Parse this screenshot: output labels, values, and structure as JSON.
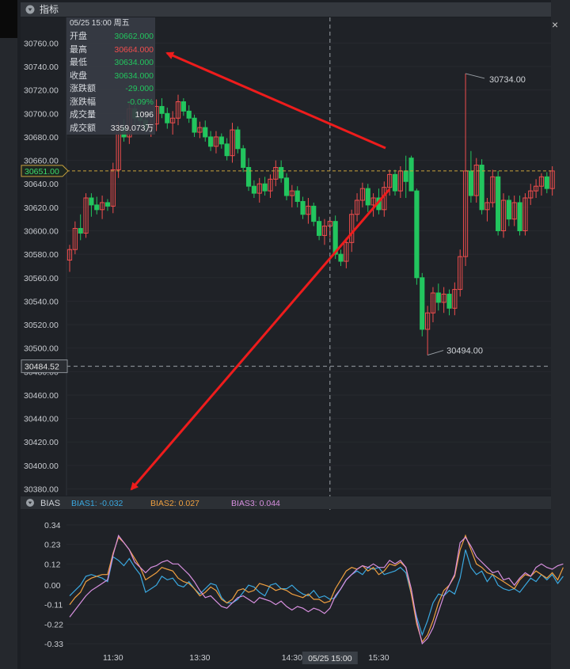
{
  "panel": {
    "title": "指标",
    "bias_title": "BIAS"
  },
  "crosshair": {
    "price_label": "30484.52",
    "time_label": "05/25 15:00",
    "ref_price_label": "30651.00"
  },
  "tooltip": {
    "header": "05/25 15:00 周五",
    "rows": [
      {
        "label": "开盘",
        "value": "30662.000",
        "tone": "dn"
      },
      {
        "label": "最高",
        "value": "30664.000",
        "tone": "up"
      },
      {
        "label": "最低",
        "value": "30634.000",
        "tone": "dn"
      },
      {
        "label": "收盘",
        "value": "30634.000",
        "tone": "dn"
      },
      {
        "label": "涨跌额",
        "value": "-29.000",
        "tone": "dn"
      },
      {
        "label": "涨跌幅",
        "value": "-0.09%",
        "tone": "dn"
      },
      {
        "label": "成交量",
        "value": "1096",
        "tone": "nt"
      },
      {
        "label": "成交额",
        "value": "3359.073万",
        "tone": "nt"
      }
    ]
  },
  "annotations": {
    "high": "30734.00",
    "low": "30494.00"
  },
  "bias_legend": [
    {
      "label": "BIAS1: -0.032",
      "color": "#3aa8e0"
    },
    {
      "label": "BIAS2: 0.027",
      "color": "#f0a040"
    },
    {
      "label": "BIAS3: 0.044",
      "color": "#d890e0"
    }
  ],
  "colors": {
    "up": "#ef4d4d",
    "down": "#22c55e",
    "arrow": "#ee1c1c"
  },
  "chart_data": [
    {
      "type": "candlestick",
      "y_ticks": [
        30380,
        30400,
        30420,
        30440,
        30460,
        30480,
        30500,
        30520,
        30540,
        30560,
        30580,
        30600,
        30620,
        30640,
        30660,
        30680,
        30700,
        30720,
        30740,
        30760
      ],
      "ylim": [
        30380,
        30765
      ],
      "ohlc": [
        [
          30575,
          30588,
          30565,
          30584
        ],
        [
          30584,
          30608,
          30580,
          30602
        ],
        [
          30602,
          30614,
          30592,
          30598
        ],
        [
          30598,
          30632,
          30594,
          30628
        ],
        [
          30628,
          30632,
          30612,
          30622
        ],
        [
          30622,
          30629,
          30614,
          30618
        ],
        [
          30618,
          30630,
          30610,
          30624
        ],
        [
          30624,
          30627,
          30617,
          30621
        ],
        [
          30621,
          30658,
          30615,
          30652
        ],
        [
          30652,
          30693,
          30645,
          30688
        ],
        [
          30688,
          30695,
          30676,
          30680
        ],
        [
          30680,
          30709,
          30674,
          30704
        ],
        [
          30704,
          30711,
          30690,
          30696
        ],
        [
          30696,
          30703,
          30687,
          30694
        ],
        [
          30694,
          30701,
          30684,
          30687
        ],
        [
          30687,
          30695,
          30680,
          30691
        ],
        [
          30691,
          30712,
          30685,
          30706
        ],
        [
          30706,
          30713,
          30696,
          30700
        ],
        [
          30700,
          30705,
          30687,
          30692
        ],
        [
          30692,
          30702,
          30682,
          30696
        ],
        [
          30696,
          30716,
          30690,
          30710
        ],
        [
          30710,
          30713,
          30698,
          30702
        ],
        [
          30702,
          30707,
          30692,
          30696
        ],
        [
          30696,
          30699,
          30680,
          30684
        ],
        [
          30684,
          30693,
          30679,
          30688
        ],
        [
          30688,
          30694,
          30676,
          30680
        ],
        [
          30680,
          30685,
          30668,
          30672
        ],
        [
          30672,
          30685,
          30666,
          30680
        ],
        [
          30680,
          30683,
          30670,
          30674
        ],
        [
          30674,
          30679,
          30660,
          30664
        ],
        [
          30664,
          30692,
          30658,
          30686
        ],
        [
          30686,
          30689,
          30666,
          30670
        ],
        [
          30670,
          30673,
          30650,
          30654
        ],
        [
          30654,
          30662,
          30634,
          30638
        ],
        [
          30638,
          30643,
          30628,
          30632
        ],
        [
          30632,
          30645,
          30624,
          30640
        ],
        [
          30640,
          30646,
          30630,
          30634
        ],
        [
          30634,
          30648,
          30628,
          30644
        ],
        [
          30644,
          30660,
          30638,
          30654
        ],
        [
          30654,
          30660,
          30641,
          30645
        ],
        [
          30645,
          30649,
          30626,
          30630
        ],
        [
          30630,
          30639,
          30620,
          30634
        ],
        [
          30634,
          30638,
          30620,
          30625
        ],
        [
          30625,
          30629,
          30610,
          30614
        ],
        [
          30614,
          30628,
          30606,
          30621
        ],
        [
          30621,
          30624,
          30604,
          30608
        ],
        [
          30608,
          30612,
          30592,
          30596
        ],
        [
          30596,
          30610,
          30588,
          30604
        ],
        [
          30604,
          30612,
          30594,
          30608
        ],
        [
          30608,
          30613,
          30576,
          30580
        ],
        [
          30580,
          30584,
          30570,
          30574
        ],
        [
          30574,
          30594,
          30568,
          30590
        ],
        [
          30590,
          30618,
          30582,
          30614
        ],
        [
          30614,
          30632,
          30608,
          30626
        ],
        [
          30626,
          30641,
          30620,
          30636
        ],
        [
          30636,
          30640,
          30616,
          30622
        ],
        [
          30622,
          30632,
          30612,
          30628
        ],
        [
          30628,
          30636,
          30614,
          30618
        ],
        [
          30618,
          30642,
          30612,
          30637
        ],
        [
          30637,
          30652,
          30630,
          30648
        ],
        [
          30648,
          30652,
          30630,
          30634
        ],
        [
          30634,
          30655,
          30628,
          30651
        ],
        [
          30651,
          30664,
          30628,
          30642
        ],
        [
          30662,
          30664,
          30634,
          30634
        ],
        [
          30634,
          30636,
          30554,
          30560
        ],
        [
          30560,
          30564,
          30510,
          30516
        ],
        [
          30516,
          30536,
          30494,
          30530
        ],
        [
          30530,
          30552,
          30522,
          30547
        ],
        [
          30547,
          30555,
          30532,
          30539
        ],
        [
          30539,
          30552,
          30530,
          30546
        ],
        [
          30546,
          30550,
          30528,
          30534
        ],
        [
          30534,
          30556,
          30528,
          30550
        ],
        [
          30550,
          30584,
          30544,
          30578
        ],
        [
          30578,
          30734,
          30570,
          30651
        ],
        [
          30651,
          30668,
          30624,
          30630
        ],
        [
          30630,
          30662,
          30624,
          30656
        ],
        [
          30656,
          30661,
          30614,
          30618
        ],
        [
          30618,
          30628,
          30608,
          30624
        ],
        [
          30624,
          30652,
          30620,
          30646
        ],
        [
          30646,
          30651,
          30596,
          30600
        ],
        [
          30600,
          30632,
          30594,
          30626
        ],
        [
          30626,
          30630,
          30604,
          30610
        ],
        [
          30610,
          30630,
          30604,
          30624
        ],
        [
          30624,
          30630,
          30596,
          30600
        ],
        [
          30600,
          30632,
          30596,
          30628
        ],
        [
          30628,
          30640,
          30622,
          30634
        ],
        [
          30634,
          30644,
          30628,
          30638
        ],
        [
          30638,
          30649,
          30630,
          30646
        ],
        [
          30646,
          30650,
          30632,
          30636
        ],
        [
          30636,
          30655,
          30630,
          30651
        ]
      ]
    },
    {
      "type": "line",
      "y_ticks": [
        -0.33,
        -0.22,
        -0.11,
        0.0,
        0.12,
        0.23,
        0.34
      ],
      "ylim": [
        -0.34,
        0.36
      ],
      "series": [
        {
          "name": "BIAS1",
          "color": "#3aa8e0",
          "values": [
            -0.06,
            -0.03,
            0.0,
            0.05,
            0.06,
            0.05,
            0.04,
            0.02,
            0.16,
            0.14,
            0.11,
            0.15,
            0.1,
            0.06,
            -0.04,
            -0.02,
            0.0,
            0.05,
            0.03,
            0.04,
            0.0,
            -0.01,
            0.02,
            -0.02,
            -0.05,
            -0.02,
            0.01,
            0.0,
            -0.07,
            -0.1,
            -0.1,
            -0.08,
            -0.04,
            0.0,
            -0.01,
            -0.04,
            -0.06,
            0.0,
            0.01,
            -0.02,
            -0.02,
            0.0,
            -0.03,
            -0.05,
            -0.06,
            -0.03,
            -0.07,
            -0.06,
            -0.08,
            -0.07,
            -0.02,
            0.03,
            0.06,
            0.08,
            0.06,
            0.1,
            0.09,
            0.1,
            0.06,
            0.07,
            0.08,
            0.1,
            0.07,
            -0.05,
            -0.18,
            -0.28,
            -0.2,
            -0.1,
            -0.05,
            -0.06,
            -0.03,
            -0.05,
            0.04,
            0.2,
            0.1,
            0.06,
            0.08,
            0.02,
            0.06,
            0.0,
            -0.02,
            -0.03,
            -0.02,
            -0.04,
            0.0,
            0.04,
            0.02,
            0.06,
            0.03,
            0.06,
            0.01,
            0.05
          ]
        },
        {
          "name": "BIAS2",
          "color": "#f0a040",
          "values": [
            -0.11,
            -0.07,
            -0.04,
            0.02,
            0.04,
            0.05,
            0.06,
            0.06,
            0.18,
            0.27,
            0.24,
            0.2,
            0.15,
            0.1,
            0.03,
            0.05,
            0.07,
            0.1,
            0.09,
            0.08,
            0.04,
            0.02,
            0.01,
            -0.02,
            -0.06,
            -0.04,
            -0.01,
            -0.03,
            -0.08,
            -0.1,
            -0.08,
            -0.03,
            -0.02,
            -0.04,
            -0.03,
            0.01,
            0.0,
            -0.01,
            -0.03,
            -0.02,
            -0.03,
            -0.05,
            -0.06,
            -0.07,
            -0.05,
            -0.08,
            -0.08,
            -0.1,
            -0.09,
            -0.02,
            0.03,
            0.08,
            0.1,
            0.09,
            0.11,
            0.08,
            0.1,
            0.06,
            0.08,
            0.12,
            0.11,
            0.13,
            0.1,
            -0.05,
            -0.22,
            -0.32,
            -0.28,
            -0.2,
            -0.1,
            -0.03,
            0.0,
            0.05,
            0.2,
            0.28,
            0.2,
            0.12,
            0.1,
            0.07,
            0.06,
            0.04,
            0.02,
            0.0,
            -0.02,
            0.03,
            0.06,
            0.05,
            0.08,
            0.06,
            0.04,
            0.07,
            0.03,
            0.1
          ]
        },
        {
          "name": "BIAS3",
          "color": "#d890e0",
          "values": [
            -0.18,
            -0.14,
            -0.1,
            -0.06,
            -0.03,
            -0.01,
            0.01,
            0.03,
            0.17,
            0.28,
            0.24,
            0.2,
            0.13,
            0.1,
            0.07,
            0.1,
            0.11,
            0.13,
            0.14,
            0.12,
            0.12,
            0.09,
            0.06,
            0.02,
            -0.03,
            -0.07,
            -0.06,
            -0.09,
            -0.12,
            -0.13,
            -0.1,
            -0.07,
            -0.06,
            -0.08,
            -0.1,
            -0.07,
            -0.08,
            -0.09,
            -0.11,
            -0.09,
            -0.12,
            -0.14,
            -0.12,
            -0.13,
            -0.15,
            -0.13,
            -0.14,
            -0.16,
            -0.13,
            -0.06,
            -0.02,
            0.03,
            0.06,
            0.09,
            0.11,
            0.1,
            0.12,
            0.1,
            0.1,
            0.14,
            0.12,
            0.14,
            0.1,
            -0.02,
            -0.2,
            -0.33,
            -0.3,
            -0.24,
            -0.15,
            -0.06,
            0.0,
            0.06,
            0.24,
            0.27,
            0.22,
            0.16,
            0.13,
            0.1,
            0.07,
            0.08,
            0.03,
            0.04,
            0.0,
            0.04,
            0.07,
            0.05,
            0.1,
            0.12,
            0.1,
            0.09,
            0.11,
            0.12
          ]
        }
      ]
    }
  ],
  "x_axis": {
    "ticks": [
      {
        "label": "11:30",
        "index": 8
      },
      {
        "label": "13:30",
        "index": 24
      },
      {
        "label": "14:30",
        "index": 41
      },
      {
        "label": "15:30",
        "index": 57
      }
    ],
    "highlight_index": 48
  }
}
